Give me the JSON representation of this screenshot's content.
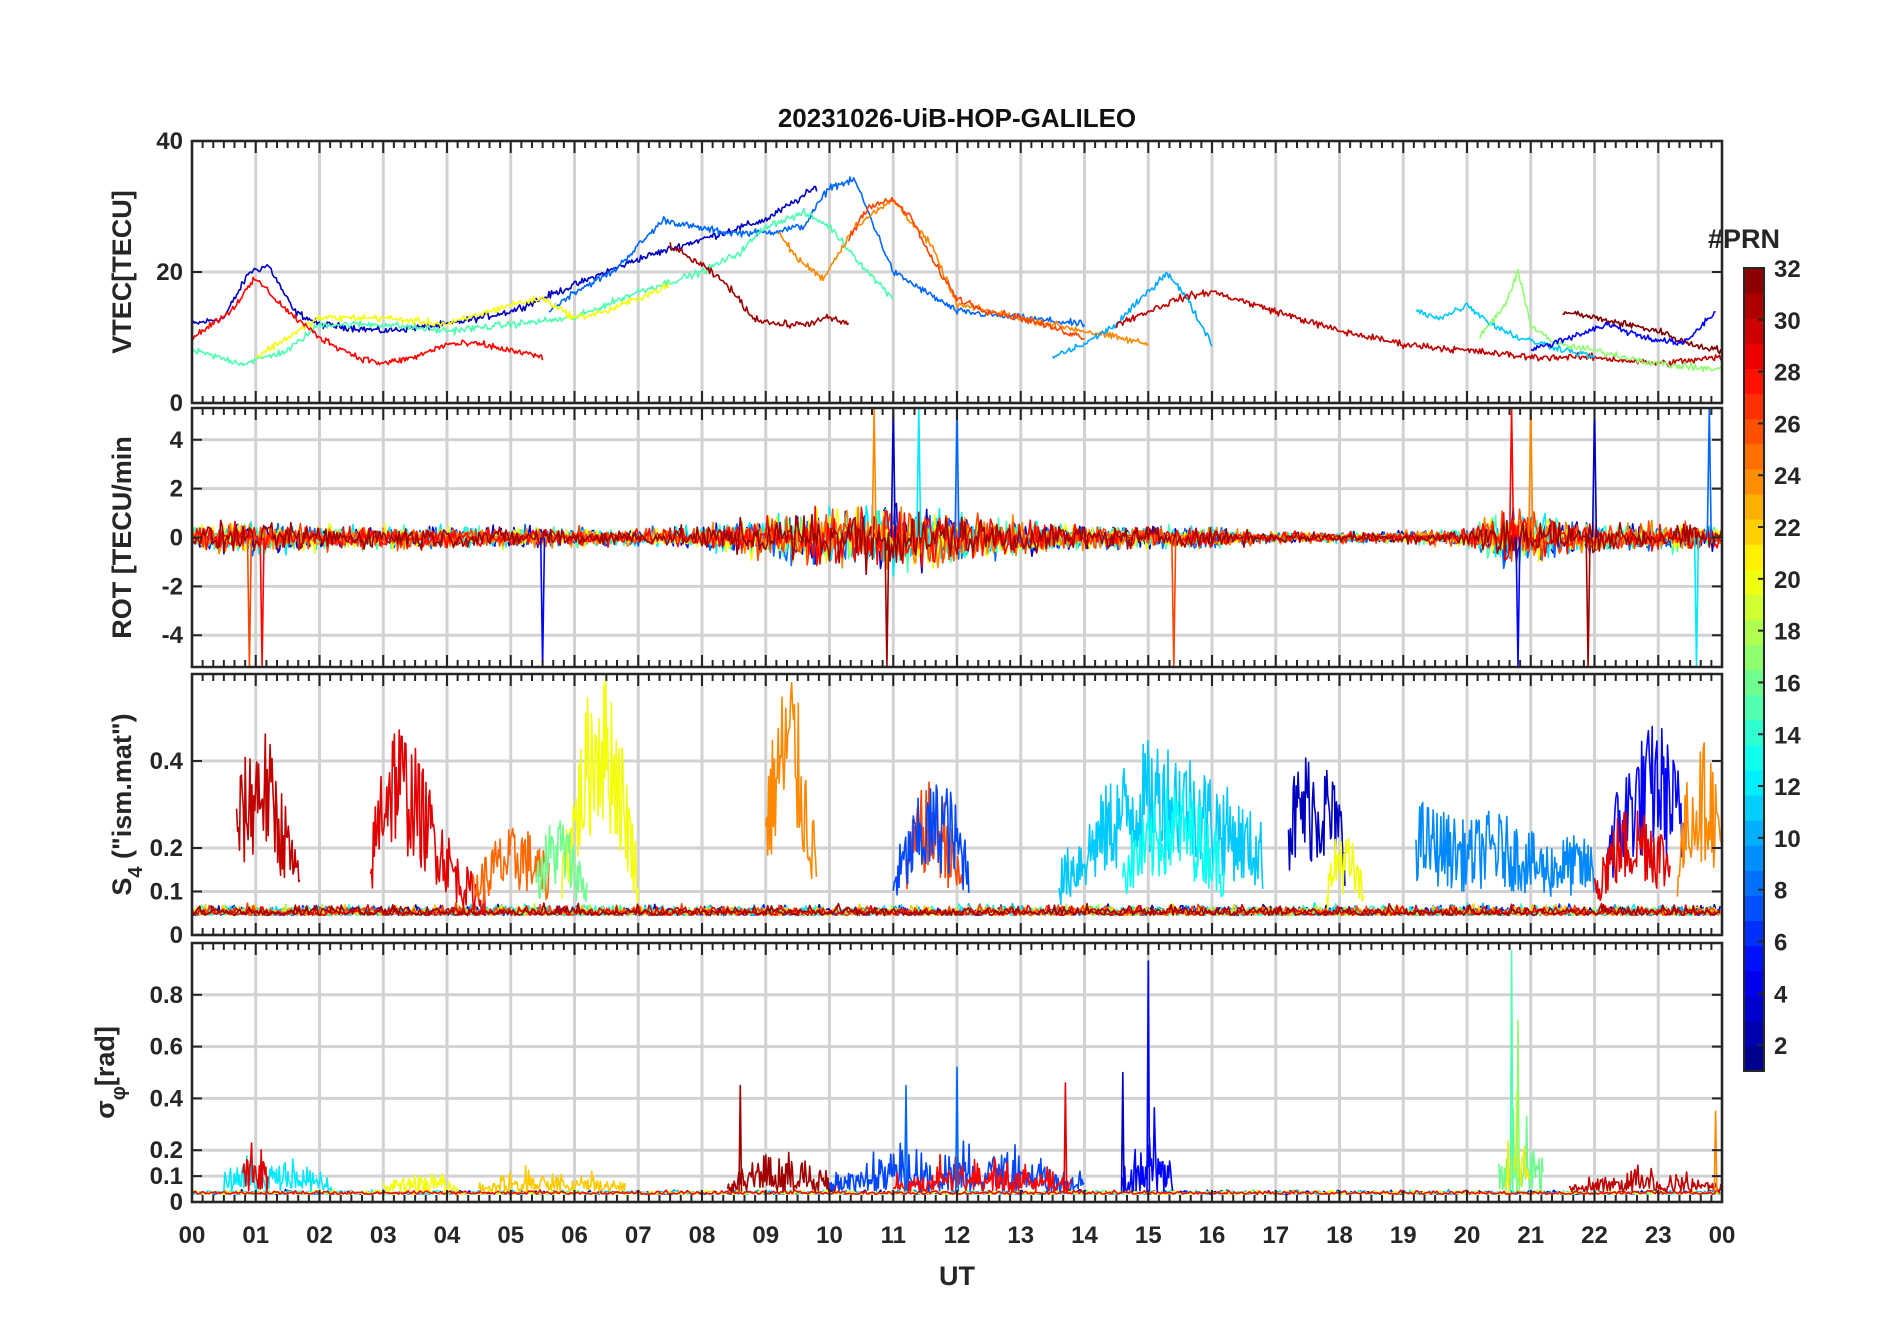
{
  "figure": {
    "title": "20231026-UiB-HOP-GALILEO",
    "xlabel": "UT"
  },
  "chart_data": [
    {
      "type": "line",
      "panel": "VTEC",
      "ylabel": "VTEC[TECU]",
      "ylim": [
        0,
        40
      ],
      "yticks": [
        0,
        20,
        40
      ],
      "xlim": [
        0,
        24
      ],
      "grid": true,
      "series": [
        {
          "prn": 3,
          "x": [
            0.0,
            0.5,
            0.9,
            1.2,
            1.6,
            2.0,
            3.0,
            4.0,
            5.0,
            6.0,
            7.0,
            8.0,
            9.0,
            9.5,
            9.8
          ],
          "y": [
            12,
            13,
            20,
            21,
            14,
            12,
            11,
            12,
            14,
            18,
            22,
            25,
            28,
            31,
            33
          ]
        },
        {
          "prn": 8,
          "x": [
            5.6,
            6.0,
            6.6,
            7.0,
            7.4,
            7.8,
            8.4,
            9.0,
            9.6,
            10.0,
            10.4,
            11.0,
            12.0,
            13.0,
            14.0
          ],
          "y": [
            14,
            17,
            20,
            24,
            28,
            27,
            26,
            26,
            27,
            33,
            34,
            20,
            14,
            13,
            12
          ]
        },
        {
          "prn": 15,
          "x": [
            0.0,
            0.8,
            1.5,
            2.0,
            3.0,
            4.0,
            5.0,
            6.0,
            7.0,
            8.0,
            8.6,
            9.0,
            9.6,
            10.0,
            10.6,
            11.0
          ],
          "y": [
            8,
            6,
            8,
            12,
            12,
            11,
            12,
            13,
            17,
            20,
            23,
            27,
            29,
            27,
            20,
            16
          ]
        },
        {
          "prn": 20,
          "x": [
            1.0,
            2.0,
            3.0,
            4.0,
            5.0,
            5.5,
            6.0,
            6.5,
            7.0,
            7.5
          ],
          "y": [
            7,
            13,
            13,
            12,
            15,
            16,
            13,
            14,
            16,
            18
          ]
        },
        {
          "prn": 24,
          "x": [
            9.2,
            9.5,
            9.9,
            10.4,
            11.0,
            11.6,
            12.0,
            13.0,
            14.0,
            15.0
          ],
          "y": [
            26,
            22,
            19,
            27,
            31,
            24,
            15,
            13,
            11,
            9
          ]
        },
        {
          "prn": 26,
          "x": [
            10.3,
            10.6,
            11.0,
            11.3,
            11.6,
            12.0,
            12.5,
            13.0,
            14.0
          ],
          "y": [
            25,
            30,
            31,
            28,
            22,
            16,
            14,
            13,
            10
          ]
        },
        {
          "prn": 28,
          "x": [
            0.0,
            0.6,
            1.0,
            1.5,
            2.0,
            2.6,
            3.0,
            3.5,
            4.0,
            4.5,
            5.0,
            5.5
          ],
          "y": [
            10,
            14,
            19,
            14,
            10,
            7,
            6,
            7,
            9,
            9,
            8,
            7
          ]
        },
        {
          "prn": 31,
          "x": [
            7.5,
            8.0,
            8.4,
            8.8,
            9.2,
            9.6,
            10.0,
            10.3
          ],
          "y": [
            24,
            21,
            18,
            13,
            12,
            12,
            13,
            12
          ]
        },
        {
          "prn": 10,
          "x": [
            13.5,
            14.0,
            14.5,
            15.0,
            15.3,
            15.6,
            16.0
          ],
          "y": [
            7,
            9,
            12,
            17,
            20,
            16,
            9
          ]
        },
        {
          "prn": 30,
          "x": [
            14.5,
            15.0,
            15.5,
            16.0,
            17.0,
            18.0,
            19.0,
            20.0,
            21.0,
            22.0,
            23.0,
            24.0
          ],
          "y": [
            12,
            14,
            16,
            17,
            14,
            11,
            9,
            8,
            7,
            7,
            6,
            7
          ]
        },
        {
          "prn": 11,
          "x": [
            19.2,
            19.6,
            20.0,
            20.4,
            20.8,
            21.2,
            21.6,
            22.0
          ],
          "y": [
            14,
            13,
            15,
            12,
            10,
            9,
            8,
            7
          ]
        },
        {
          "prn": 17,
          "x": [
            20.2,
            20.6,
            20.8,
            21.0,
            21.4,
            22.0,
            23.0,
            24.0
          ],
          "y": [
            10,
            15,
            20,
            12,
            9,
            8,
            6,
            5
          ]
        },
        {
          "prn": 32,
          "x": [
            21.5,
            22.0,
            22.5,
            23.0,
            23.5,
            24.0
          ],
          "y": [
            14,
            13,
            12,
            11,
            9,
            8
          ]
        },
        {
          "prn": 5,
          "x": [
            21.0,
            21.6,
            22.2,
            22.8,
            23.4,
            23.9
          ],
          "y": [
            8,
            10,
            12,
            10,
            9,
            14
          ]
        }
      ]
    },
    {
      "type": "line",
      "panel": "ROT",
      "ylabel": "ROT [TECU/min",
      "ylim": [
        -5.3,
        5.3
      ],
      "yticks": [
        -4,
        -2,
        0,
        2,
        4
      ],
      "xlim": [
        0,
        24
      ],
      "grid": true,
      "activity_profile": {
        "x": [
          0,
          1,
          2,
          3,
          4,
          5,
          6,
          7,
          8,
          9,
          10,
          11,
          12,
          13,
          14,
          15,
          16,
          17,
          18,
          19,
          20,
          20.7,
          21,
          22,
          23,
          24
        ],
        "amplitude": [
          1.5,
          1.6,
          1.2,
          1.2,
          1.1,
          1.0,
          1.0,
          0.8,
          1.2,
          2.2,
          2.8,
          3.2,
          2.4,
          1.8,
          1.2,
          1.2,
          1.0,
          0.6,
          0.5,
          0.6,
          0.9,
          3.0,
          2.5,
          1.4,
          1.4,
          1.2
        ]
      },
      "spikes": [
        {
          "x": 0.9,
          "y": -5.3
        },
        {
          "x": 1.1,
          "y": -5.3
        },
        {
          "x": 5.5,
          "y": -5.3
        },
        {
          "x": 10.7,
          "y": 5.3
        },
        {
          "x": 10.9,
          "y": -5.3
        },
        {
          "x": 11.0,
          "y": 5.3
        },
        {
          "x": 11.4,
          "y": 5.3
        },
        {
          "x": 12.0,
          "y": 5.3
        },
        {
          "x": 15.4,
          "y": -5.3
        },
        {
          "x": 20.7,
          "y": 5.3
        },
        {
          "x": 20.8,
          "y": -5.3
        },
        {
          "x": 21.0,
          "y": 5.3
        },
        {
          "x": 21.9,
          "y": -5.3
        },
        {
          "x": 22.0,
          "y": 5.3
        },
        {
          "x": 23.6,
          "y": -5.3
        },
        {
          "x": 23.8,
          "y": 5.3
        }
      ],
      "prns": [
        3,
        8,
        12,
        15,
        20,
        24,
        26,
        28,
        31
      ]
    },
    {
      "type": "line",
      "panel": "S4",
      "ylabel": "S",
      "ylabel_subscript": "4",
      "ylabel_suffix": " (\"ism.mat\")",
      "ylim": [
        0,
        0.6
      ],
      "yticks": [
        0,
        0.1,
        0.2,
        0.4
      ],
      "xlim": [
        0,
        24
      ],
      "grid": true,
      "series": [
        {
          "prn": 30,
          "x": [
            0.7,
            0.9,
            1.1,
            1.3,
            1.5,
            1.7
          ],
          "y": [
            0.25,
            0.3,
            0.35,
            0.28,
            0.2,
            0.1
          ]
        },
        {
          "prn": 29,
          "x": [
            2.8,
            3.0,
            3.2,
            3.5,
            3.8,
            4.2,
            4.6
          ],
          "y": [
            0.15,
            0.32,
            0.36,
            0.3,
            0.22,
            0.12,
            0.08
          ]
        },
        {
          "prn": 25,
          "x": [
            4.4,
            4.8,
            5.2,
            5.6
          ],
          "y": [
            0.1,
            0.16,
            0.18,
            0.12
          ]
        },
        {
          "prn": 20,
          "x": [
            5.8,
            6.0,
            6.2,
            6.4,
            6.6,
            6.8,
            7.0
          ],
          "y": [
            0.15,
            0.25,
            0.38,
            0.45,
            0.4,
            0.28,
            0.12
          ]
        },
        {
          "prn": 16,
          "x": [
            5.4,
            5.6,
            5.8,
            6.0,
            6.2
          ],
          "y": [
            0.12,
            0.18,
            0.2,
            0.15,
            0.1
          ]
        },
        {
          "prn": 24,
          "x": [
            9.0,
            9.2,
            9.4,
            9.6,
            9.8
          ],
          "y": [
            0.25,
            0.38,
            0.45,
            0.3,
            0.15
          ]
        },
        {
          "prn": 26,
          "x": [
            11.2,
            11.5,
            11.8,
            12.1
          ],
          "y": [
            0.15,
            0.25,
            0.22,
            0.1
          ]
        },
        {
          "prn": 7,
          "x": [
            11.0,
            11.4,
            11.8,
            12.2
          ],
          "y": [
            0.12,
            0.22,
            0.26,
            0.15
          ]
        },
        {
          "prn": 11,
          "x": [
            13.6,
            14.0,
            14.4,
            14.8,
            15.2,
            15.6,
            16.0,
            16.4,
            16.8
          ],
          "y": [
            0.12,
            0.18,
            0.25,
            0.3,
            0.32,
            0.3,
            0.26,
            0.22,
            0.18
          ]
        },
        {
          "prn": 13,
          "x": [
            14.6,
            15.0,
            15.4,
            15.8,
            16.2
          ],
          "y": [
            0.15,
            0.2,
            0.25,
            0.22,
            0.15
          ]
        },
        {
          "prn": 3,
          "x": [
            17.2,
            17.5,
            17.8,
            18.1
          ],
          "y": [
            0.25,
            0.3,
            0.28,
            0.2
          ]
        },
        {
          "prn": 20,
          "x": [
            17.8,
            18.0,
            18.2,
            18.4
          ],
          "y": [
            0.1,
            0.18,
            0.15,
            0.08
          ]
        },
        {
          "prn": 9,
          "x": [
            19.2,
            19.6,
            20.0,
            20.4,
            20.8,
            21.2,
            21.6,
            22.0
          ],
          "y": [
            0.22,
            0.2,
            0.18,
            0.2,
            0.18,
            0.15,
            0.16,
            0.15
          ]
        },
        {
          "prn": 5,
          "x": [
            22.2,
            22.6,
            23.0,
            23.4
          ],
          "y": [
            0.2,
            0.3,
            0.35,
            0.25
          ]
        },
        {
          "prn": 29,
          "x": [
            22.0,
            22.4,
            22.8,
            23.2
          ],
          "y": [
            0.12,
            0.2,
            0.22,
            0.15
          ]
        },
        {
          "prn": 24,
          "x": [
            23.3,
            23.5,
            23.8,
            24.0
          ],
          "y": [
            0.15,
            0.28,
            0.32,
            0.2
          ]
        }
      ],
      "baseline": {
        "mean": 0.06,
        "noise": 0.03
      }
    },
    {
      "type": "line",
      "panel": "SigmaPhi",
      "ylabel": "σ",
      "ylabel_subscript": "φ",
      "ylabel_suffix": "[rad]",
      "ylim": [
        0,
        1.0
      ],
      "yticks": [
        0,
        0.1,
        0.2,
        0.4,
        0.6,
        0.8
      ],
      "xlim": [
        0,
        24
      ],
      "grid": true,
      "bursts": [
        {
          "prn": 12,
          "x0": 0.5,
          "x1": 2.2,
          "peak": 0.2
        },
        {
          "prn": 29,
          "x0": 0.8,
          "x1": 1.2,
          "peak": 0.3
        },
        {
          "prn": 20,
          "x0": 3.0,
          "x1": 4.2,
          "peak": 0.12
        },
        {
          "prn": 22,
          "x0": 4.5,
          "x1": 6.8,
          "peak": 0.12
        },
        {
          "prn": 31,
          "x0": 8.4,
          "x1": 10.2,
          "peak": 0.22
        },
        {
          "prn": 7,
          "x0": 10.0,
          "x1": 14.0,
          "peak": 0.25
        },
        {
          "prn": 28,
          "x0": 11.0,
          "x1": 13.8,
          "peak": 0.2
        },
        {
          "prn": 5,
          "x0": 14.6,
          "x1": 15.4,
          "peak": 0.35
        },
        {
          "prn": 16,
          "x0": 20.5,
          "x1": 21.2,
          "peak": 0.45
        },
        {
          "prn": 21,
          "x0": 20.6,
          "x1": 21.0,
          "peak": 0.4
        },
        {
          "prn": 30,
          "x0": 21.6,
          "x1": 24.0,
          "peak": 0.12
        }
      ],
      "spikes": [
        {
          "x": 15.0,
          "y": 0.93,
          "prn": 5
        },
        {
          "x": 14.6,
          "y": 0.5,
          "prn": 3
        },
        {
          "x": 12.0,
          "y": 0.52,
          "prn": 8
        },
        {
          "x": 11.2,
          "y": 0.45,
          "prn": 8
        },
        {
          "x": 13.7,
          "y": 0.46,
          "prn": 29
        },
        {
          "x": 8.6,
          "y": 0.45,
          "prn": 31
        },
        {
          "x": 20.7,
          "y": 0.97,
          "prn": 15
        },
        {
          "x": 20.8,
          "y": 0.7,
          "prn": 17
        },
        {
          "x": 23.9,
          "y": 0.35,
          "prn": 24
        }
      ],
      "baseline": {
        "mean": 0.04,
        "noise": 0.02
      }
    }
  ],
  "xaxis": {
    "ticks": [
      "00",
      "01",
      "02",
      "03",
      "04",
      "05",
      "06",
      "07",
      "08",
      "09",
      "10",
      "11",
      "12",
      "13",
      "14",
      "15",
      "16",
      "17",
      "18",
      "19",
      "20",
      "21",
      "22",
      "23",
      "00"
    ]
  },
  "colorbar": {
    "label": "#PRN",
    "range": [
      1,
      32
    ],
    "ticks": [
      "2",
      "4",
      "6",
      "8",
      "10",
      "12",
      "14",
      "16",
      "18",
      "20",
      "22",
      "24",
      "26",
      "28",
      "30",
      "32"
    ],
    "colormap": "jet"
  },
  "colors": {
    "axis": "#262626",
    "grid": "#d2d2d2"
  }
}
